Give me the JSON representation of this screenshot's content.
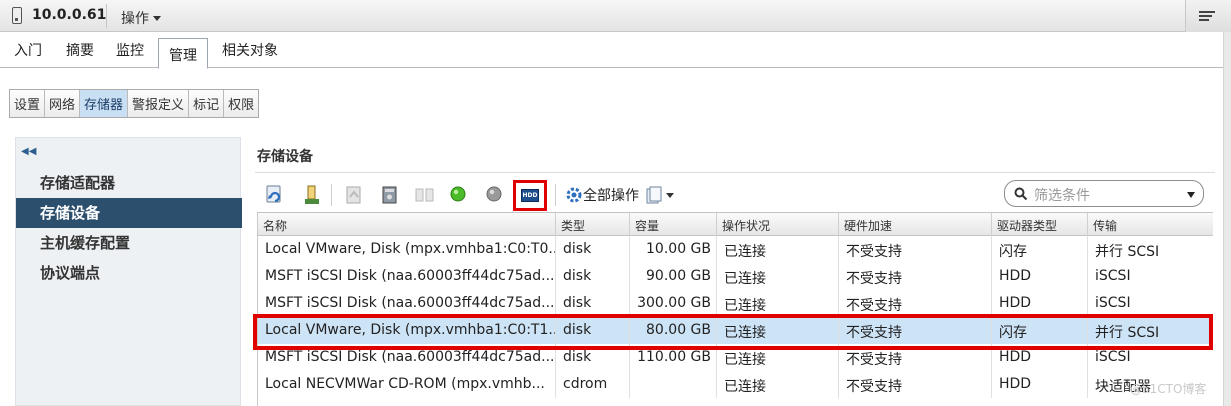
{
  "topbar": {
    "host": "10.0.0.61",
    "actions_label": "操作"
  },
  "tabs": [
    {
      "label": "入门"
    },
    {
      "label": "摘要"
    },
    {
      "label": "监控"
    },
    {
      "label": "管理",
      "active": true
    },
    {
      "label": "相关对象"
    }
  ],
  "subtabs": [
    {
      "label": "设置"
    },
    {
      "label": "网络"
    },
    {
      "label": "存储器",
      "active": true
    },
    {
      "label": "警报定义"
    },
    {
      "label": "标记"
    },
    {
      "label": "权限"
    }
  ],
  "leftnav": {
    "items": [
      {
        "label": "存储适配器"
      },
      {
        "label": "存储设备",
        "active": true
      },
      {
        "label": "主机缓存配置"
      },
      {
        "label": "协议端点"
      }
    ]
  },
  "panel": {
    "title": "存储设备",
    "all_actions_label": "全部操作",
    "hdd_button_label": "HDD",
    "filter_placeholder": "筛选条件"
  },
  "table": {
    "columns": [
      "名称",
      "类型",
      "容量",
      "操作状况",
      "硬件加速",
      "驱动器类型",
      "传输"
    ],
    "rows": [
      {
        "name": "Local VMware, Disk (mpx.vmhba1:C0:T0...",
        "type": "disk",
        "capacity": "10.00 GB",
        "status": "已连接",
        "accel": "不受支持",
        "drive": "闪存",
        "transport": "并行 SCSI"
      },
      {
        "name": "MSFT iSCSI Disk (naa.60003ff44dc75ad...",
        "type": "disk",
        "capacity": "90.00 GB",
        "status": "已连接",
        "accel": "不受支持",
        "drive": "HDD",
        "transport": "iSCSI"
      },
      {
        "name": "MSFT iSCSI Disk (naa.60003ff44dc75ad...",
        "type": "disk",
        "capacity": "300.00 GB",
        "status": "已连接",
        "accel": "不受支持",
        "drive": "HDD",
        "transport": "iSCSI"
      },
      {
        "name": "Local VMware, Disk (mpx.vmhba1:C0:T1...",
        "type": "disk",
        "capacity": "80.00 GB",
        "status": "已连接",
        "accel": "不受支持",
        "drive": "闪存",
        "transport": "并行 SCSI",
        "selected": true
      },
      {
        "name": "MSFT iSCSI Disk (naa.60003ff44dc75ad...",
        "type": "disk",
        "capacity": "110.00 GB",
        "status": "已连接",
        "accel": "不受支持",
        "drive": "HDD",
        "transport": "iSCSI"
      },
      {
        "name": "Local NECVMWar CD-ROM (mpx.vmhb...",
        "type": "cdrom",
        "capacity": "",
        "status": "已连接",
        "accel": "不受支持",
        "drive": "HDD",
        "transport": "块适配器"
      }
    ]
  },
  "watermark": "@51CTO博客",
  "colors": {
    "selection": "#cde3f6",
    "nav_active": "#2d4f6e",
    "highlight_box": "#e00000"
  }
}
